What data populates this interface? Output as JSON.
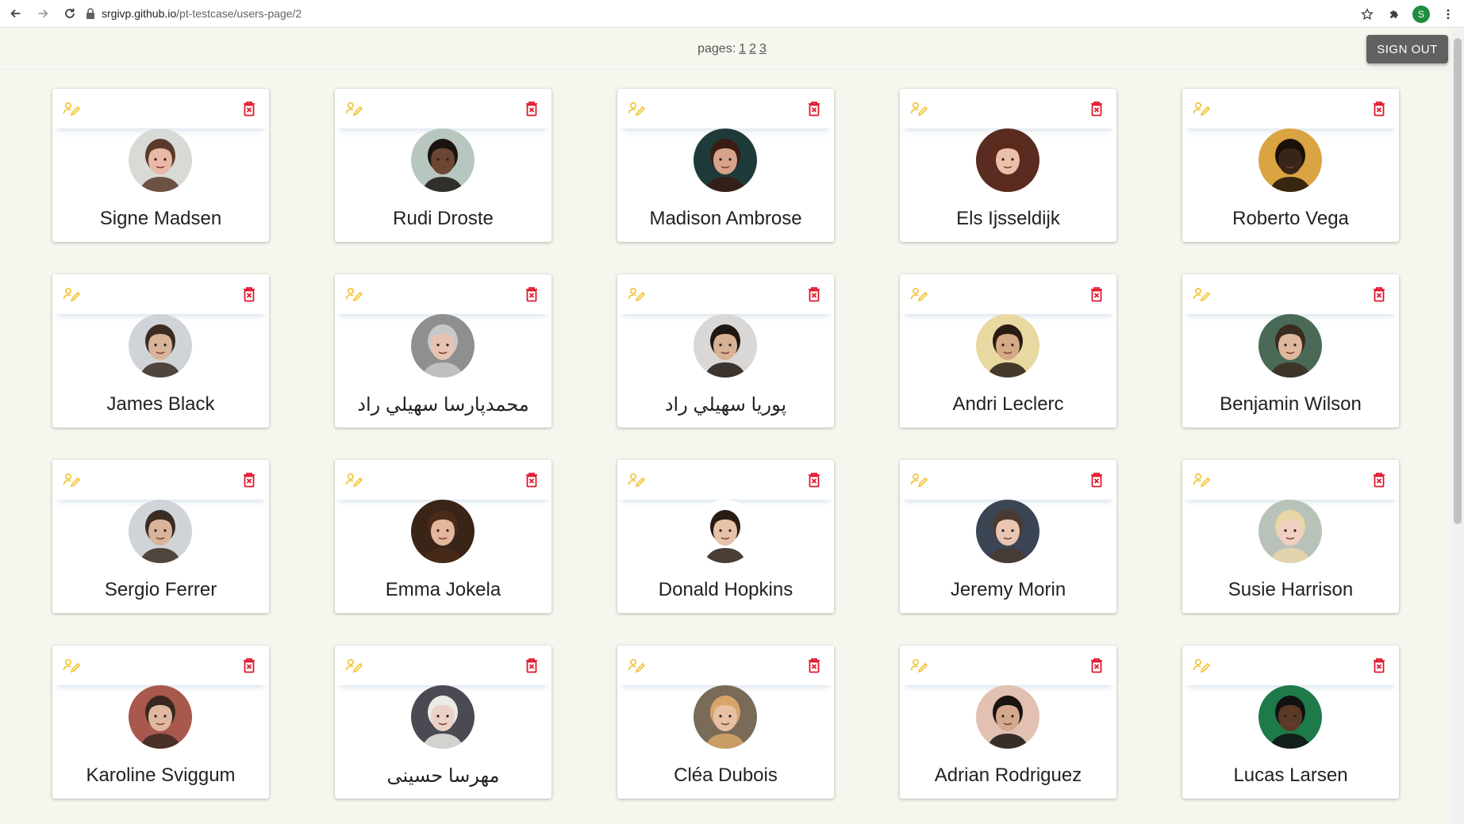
{
  "browser": {
    "url_host": "srgivp.github.io",
    "url_path": "/pt-testcase/users-page/2",
    "profile_initial": "S"
  },
  "header": {
    "pages_label": "pages:",
    "pages": [
      "1",
      "2",
      "3"
    ],
    "signout_label": "SIGN OUT"
  },
  "colors": {
    "edit_icon": "#f2c230",
    "delete_icon": "#e0182d",
    "background": "#f6f6ee"
  },
  "users": [
    {
      "name": "Signe Madsen",
      "skin": "#e9b8a6",
      "hair": "#5a3a2a",
      "bg": "#d8dad6"
    },
    {
      "name": "Rudi Droste",
      "skin": "#6b4633",
      "hair": "#1a1410",
      "bg": "#b7c7c0"
    },
    {
      "name": "Madison Ambrose",
      "skin": "#d6a38a",
      "hair": "#3a1c14",
      "bg": "#1e3b39"
    },
    {
      "name": "Els Ijsseldijk",
      "skin": "#eac0a8",
      "hair": "#5b2a1c",
      "bg": "#5a2b20"
    },
    {
      "name": "Roberto Vega",
      "skin": "#3a2618",
      "hair": "#1a1008",
      "bg": "#d9a441"
    },
    {
      "name": "James Black",
      "skin": "#d8b49a",
      "hair": "#3a2c22",
      "bg": "#d0d4d8"
    },
    {
      "name": "محمدپارسا سهيلي راد",
      "skin": "#e6c3b2",
      "hair": "#c8c8c8",
      "bg": "#8d8f91"
    },
    {
      "name": "پوريا سهيلي راد",
      "skin": "#d7b294",
      "hair": "#1f1712",
      "bg": "#dad8d6"
    },
    {
      "name": "Andri Leclerc",
      "skin": "#d5a986",
      "hair": "#2a1c14",
      "bg": "#e8d9a2"
    },
    {
      "name": "Benjamin Wilson",
      "skin": "#e0b89e",
      "hair": "#3a2b20",
      "bg": "#4a6a57"
    },
    {
      "name": "Sergio Ferrer",
      "skin": "#d8b49a",
      "hair": "#3a2c22",
      "bg": "#d0d4d8"
    },
    {
      "name": "Emma Jokela",
      "skin": "#e3b79c",
      "hair": "#4a2a18",
      "bg": "#3a2418"
    },
    {
      "name": "Donald Hopkins",
      "skin": "#e6c2a8",
      "hair": "#2a1c14",
      "bg": "#ffffff"
    },
    {
      "name": "Jeremy Morin",
      "skin": "#e8c6b2",
      "hair": "#4a3a30",
      "bg": "#3b4554"
    },
    {
      "name": "Susie Harrison",
      "skin": "#f0d0c0",
      "hair": "#e8d6a8",
      "bg": "#b9c2b8"
    },
    {
      "name": "Karoline Sviggum",
      "skin": "#e0b8a2",
      "hair": "#3a2820",
      "bg": "#a8584c"
    },
    {
      "name": "مهرسا حسینی",
      "skin": "#ecd2c6",
      "hair": "#eceae4",
      "bg": "#4a4a52"
    },
    {
      "name": "Cléa Dubois",
      "skin": "#e8c0a4",
      "hair": "#d8a468",
      "bg": "#7a6a58"
    },
    {
      "name": "Adrian Rodriguez",
      "skin": "#d4a88c",
      "hair": "#1a1410",
      "bg": "#e2c0b2"
    },
    {
      "name": "Lucas Larsen",
      "skin": "#5a3a26",
      "hair": "#111111",
      "bg": "#1f7a4a"
    }
  ]
}
